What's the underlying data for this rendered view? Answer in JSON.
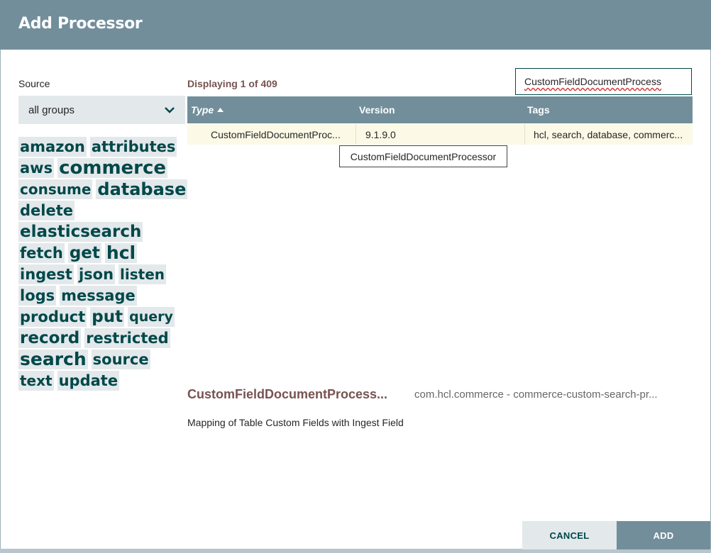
{
  "dialog": {
    "title": "Add Processor"
  },
  "source": {
    "label": "Source",
    "selected": "all groups"
  },
  "tags": [
    {
      "label": "amazon",
      "size": 21
    },
    {
      "label": "attributes",
      "size": 21
    },
    {
      "label": "aws",
      "size": 21
    },
    {
      "label": "commerce",
      "size": 26
    },
    {
      "label": "consume",
      "size": 20
    },
    {
      "label": "database",
      "size": 24
    },
    {
      "label": "delete",
      "size": 21
    },
    {
      "label": "elasticsearch",
      "size": 23
    },
    {
      "label": "fetch",
      "size": 21
    },
    {
      "label": "get",
      "size": 23
    },
    {
      "label": "hcl",
      "size": 25
    },
    {
      "label": "ingest",
      "size": 21
    },
    {
      "label": "json",
      "size": 21
    },
    {
      "label": "listen",
      "size": 20
    },
    {
      "label": "logs",
      "size": 21
    },
    {
      "label": "message",
      "size": 21
    },
    {
      "label": "product",
      "size": 21
    },
    {
      "label": "put",
      "size": 23
    },
    {
      "label": "query",
      "size": 19
    },
    {
      "label": "record",
      "size": 23
    },
    {
      "label": "restricted",
      "size": 21
    },
    {
      "label": "search",
      "size": 25
    },
    {
      "label": "source",
      "size": 21
    },
    {
      "label": "text",
      "size": 20
    },
    {
      "label": "update",
      "size": 21
    }
  ],
  "listing": {
    "count_text": "Displaying 1 of 409",
    "filter_value": "CustomFieldDocumentProcess",
    "columns": {
      "type": "Type",
      "version": "Version",
      "tags": "Tags"
    },
    "rows": [
      {
        "type": "CustomFieldDocumentProc...",
        "version": "9.1.9.0",
        "tags": "hcl, search, database, commerc..."
      }
    ],
    "tooltip": "CustomFieldDocumentProcessor"
  },
  "selected": {
    "name": "CustomFieldDocumentProcess...",
    "bundle": "com.hcl.commerce - commerce-custom-search-pr...",
    "description": "Mapping of Table Custom Fields with Ingest Field"
  },
  "buttons": {
    "cancel": "CANCEL",
    "add": "ADD"
  },
  "colors": {
    "header": "#728e9b",
    "tag_bg": "#e3e8eb",
    "tag_text": "#004849",
    "accent": "#775351",
    "row_highlight": "#fcf9e6"
  }
}
